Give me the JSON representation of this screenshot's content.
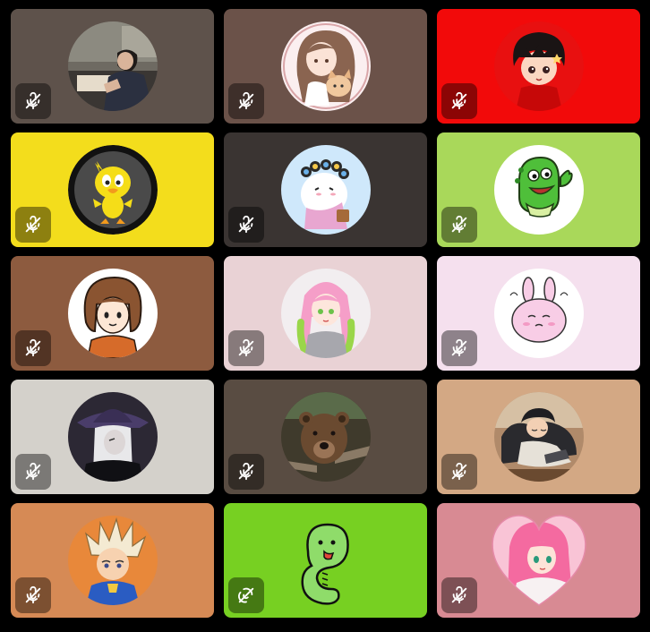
{
  "participants": [
    {
      "avatar": "man-in-suit-reading-photo",
      "tile_color": "#5e524b",
      "status_icon": "mic-off-icon"
    },
    {
      "avatar": "girl-holding-puppy-drawing",
      "tile_color": "#6b5249",
      "status_icon": "mic-off-icon"
    },
    {
      "avatar": "anime-boy-red-background",
      "tile_color": "#f20a0a",
      "status_icon": "mic-off-icon"
    },
    {
      "avatar": "yellow-bird-cartoon",
      "tile_color": "#f3dd1c",
      "status_icon": "mic-off-icon"
    },
    {
      "avatar": "white-creature-with-hair-rollers",
      "tile_color": "#3a3432",
      "status_icon": "mic-off-icon"
    },
    {
      "avatar": "green-dinosaur-waving",
      "tile_color": "#a9d85a",
      "status_icon": "mic-off-icon"
    },
    {
      "avatar": "brown-hair-girl-cartoon",
      "tile_color": "#8d5b3f",
      "status_icon": "mic-off-icon"
    },
    {
      "avatar": "anime-girl-pink-green-braids",
      "tile_color": "#e9d2d5",
      "status_icon": "mic-off-icon"
    },
    {
      "avatar": "pink-bunny-cartoon",
      "tile_color": "#f5e0ee",
      "status_icon": "mic-off-icon"
    },
    {
      "avatar": "white-haired-anime-man-hat",
      "tile_color": "#d4d1cb",
      "status_icon": "mic-off-icon"
    },
    {
      "avatar": "brown-bear-photo",
      "tile_color": "#594c42",
      "status_icon": "mic-off-icon"
    },
    {
      "avatar": "sleeping-anime-boy-couch",
      "tile_color": "#d3a884",
      "status_icon": "mic-off-icon"
    },
    {
      "avatar": "spiky-hair-soccer-boy",
      "tile_color": "#d68a55",
      "status_icon": "mic-off-icon"
    },
    {
      "avatar": "green-snake-doodle",
      "tile_color": "#77d022",
      "status_icon": "video-off-icon"
    },
    {
      "avatar": "pink-hair-anime-girl-heart",
      "tile_color": "#d88a93",
      "status_icon": "mic-off-icon"
    }
  ]
}
